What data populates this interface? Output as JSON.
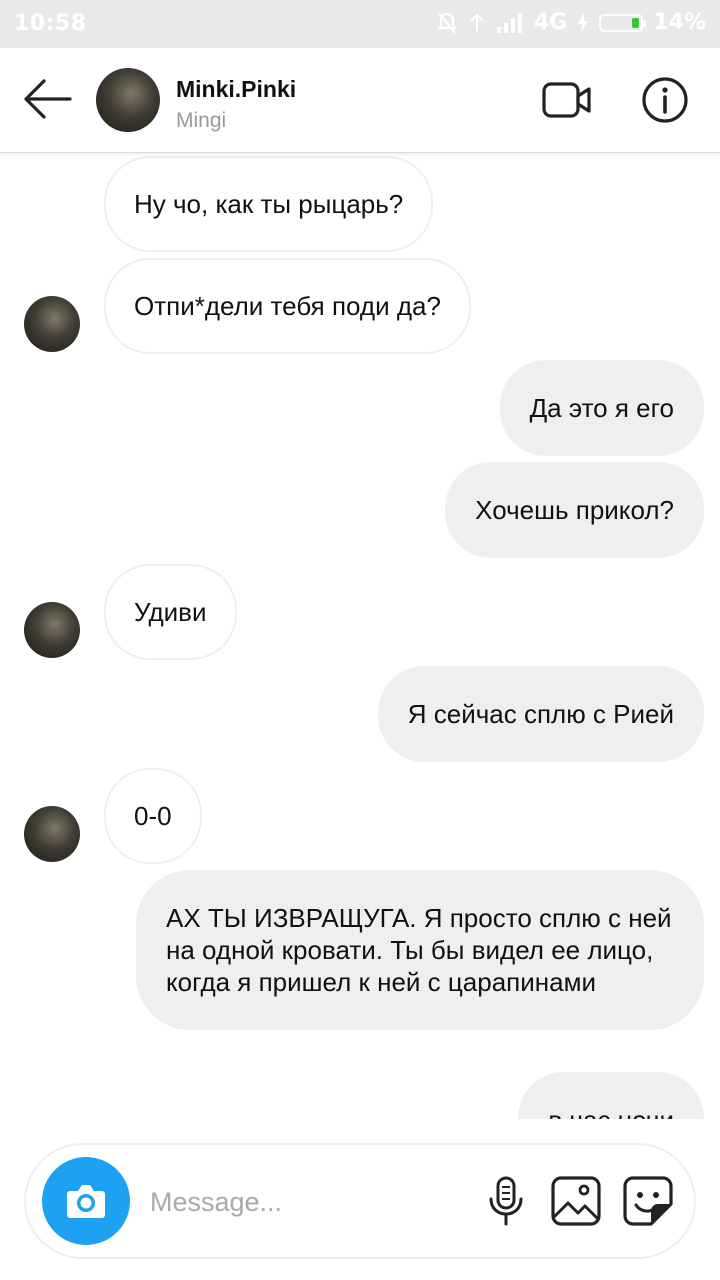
{
  "status_bar": {
    "time": "10:58",
    "network": "4G",
    "battery": "14%",
    "battery_level": 0.14
  },
  "header": {
    "username": "Minki.Pinki",
    "subtitle": "Mingi",
    "icons": [
      "back-arrow-icon",
      "video-camera-icon",
      "info-icon"
    ]
  },
  "messages": [
    {
      "side": "in",
      "text": "Ну чо, как ты рыцарь?",
      "avatar": false
    },
    {
      "side": "in",
      "text": "Отпи*дели тебя поди да?",
      "avatar": true
    },
    {
      "side": "out",
      "text": "Да это я его"
    },
    {
      "side": "out",
      "text": "Хочешь прикол?"
    },
    {
      "side": "in",
      "text": "Удиви",
      "avatar": true
    },
    {
      "side": "out",
      "text": "Я сейчас сплю с Рией"
    },
    {
      "side": "in",
      "text": "0-0",
      "avatar": true
    },
    {
      "side": "out",
      "text": "АХ ТЫ ИЗВРАЩУГА. Я просто сплю с ней на одной кровати. Ты бы видел ее лицо, когда я пришел к ней с царапинами"
    },
    {
      "side": "out",
      "text": "в час ночи"
    }
  ],
  "composer": {
    "placeholder": "Message...",
    "value": "",
    "icons": [
      "camera-icon",
      "microphone-icon",
      "gallery-icon",
      "sticker-icon"
    ],
    "accent_color": "#1da1f2"
  }
}
